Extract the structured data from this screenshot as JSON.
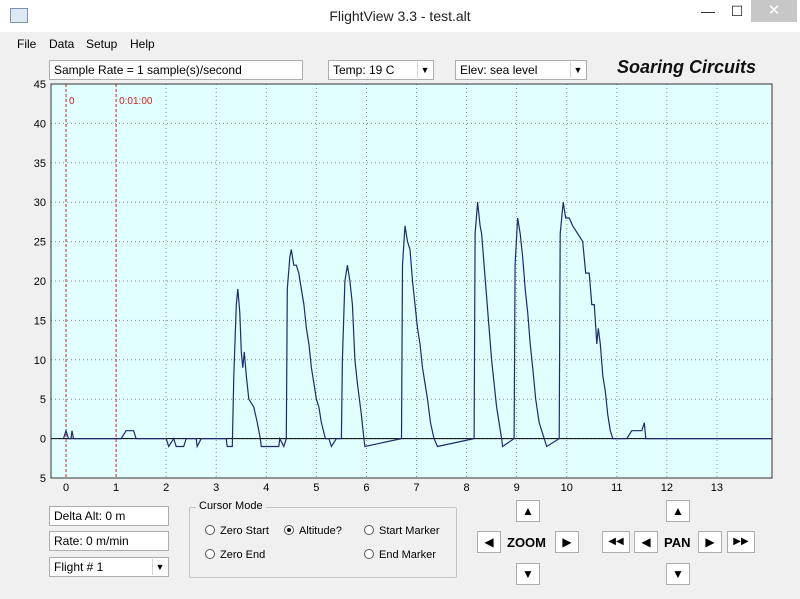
{
  "window": {
    "title": "FlightView 3.3 - test.alt",
    "minimize_glyph": "—",
    "maximize_glyph": "☐",
    "close_glyph": "✕"
  },
  "menu": [
    "File",
    "Data",
    "Setup",
    "Help"
  ],
  "toolbar": {
    "sample_rate": "Sample Rate =  1 sample(s)/second",
    "temp": "Temp:  19 C",
    "elev": "Elev: sea level",
    "brand": "Soaring Circuits"
  },
  "chart_data": {
    "type": "line",
    "x_ticks": [
      "0",
      "1",
      "2",
      "3",
      "4",
      "5",
      "6",
      "7",
      "8",
      "9",
      "10",
      "11",
      "12",
      "13"
    ],
    "y_ticks": [
      "45",
      "40",
      "35",
      "30",
      "25",
      "20",
      "15",
      "10",
      "5",
      "0",
      "5"
    ],
    "xlim": [
      -0.3,
      14.1
    ],
    "ylim": [
      -5,
      45
    ],
    "grid": true,
    "markers": [
      {
        "x": 0,
        "label": "0"
      },
      {
        "x": 1,
        "label": "0:01:00"
      }
    ],
    "colors": {
      "background": "#e2ffff",
      "line": "#1d2a6e",
      "marker": "#d42020",
      "grid": "#8a8a8a"
    },
    "points": [
      [
        -0.05,
        0
      ],
      [
        0.0,
        1
      ],
      [
        0.05,
        0
      ],
      [
        0.1,
        0
      ],
      [
        0.12,
        1
      ],
      [
        0.15,
        0
      ],
      [
        0.2,
        0
      ],
      [
        1.1,
        0
      ],
      [
        1.2,
        1
      ],
      [
        1.35,
        1
      ],
      [
        1.4,
        0
      ],
      [
        2.0,
        0
      ],
      [
        2.05,
        -1
      ],
      [
        2.15,
        0
      ],
      [
        2.2,
        -1
      ],
      [
        2.35,
        -1
      ],
      [
        2.4,
        0
      ],
      [
        2.6,
        0
      ],
      [
        2.62,
        -1
      ],
      [
        2.7,
        0
      ],
      [
        3.2,
        0
      ],
      [
        3.22,
        -1
      ],
      [
        3.32,
        -1
      ],
      [
        3.35,
        8
      ],
      [
        3.4,
        17
      ],
      [
        3.43,
        19
      ],
      [
        3.47,
        16
      ],
      [
        3.5,
        11
      ],
      [
        3.53,
        9
      ],
      [
        3.56,
        11
      ],
      [
        3.6,
        8
      ],
      [
        3.65,
        5
      ],
      [
        3.75,
        4
      ],
      [
        3.82,
        2
      ],
      [
        3.88,
        0
      ],
      [
        3.9,
        -1
      ],
      [
        4.25,
        -1
      ],
      [
        4.27,
        0
      ],
      [
        4.35,
        -1
      ],
      [
        4.4,
        0
      ],
      [
        4.42,
        19
      ],
      [
        4.47,
        23
      ],
      [
        4.5,
        24
      ],
      [
        4.55,
        22
      ],
      [
        4.6,
        22
      ],
      [
        4.65,
        21
      ],
      [
        4.7,
        19
      ],
      [
        4.75,
        17
      ],
      [
        4.8,
        14
      ],
      [
        4.85,
        12
      ],
      [
        4.9,
        9
      ],
      [
        4.95,
        7
      ],
      [
        5.0,
        5
      ],
      [
        5.05,
        4
      ],
      [
        5.1,
        2
      ],
      [
        5.18,
        0
      ],
      [
        5.25,
        0
      ],
      [
        5.3,
        -1
      ],
      [
        5.4,
        0
      ],
      [
        5.5,
        0
      ],
      [
        5.52,
        10
      ],
      [
        5.57,
        20
      ],
      [
        5.62,
        22
      ],
      [
        5.67,
        20
      ],
      [
        5.72,
        17
      ],
      [
        5.77,
        10
      ],
      [
        5.82,
        7
      ],
      [
        5.86,
        5
      ],
      [
        5.9,
        3
      ],
      [
        5.95,
        0
      ],
      [
        5.97,
        -1
      ],
      [
        6.7,
        0
      ],
      [
        6.72,
        22
      ],
      [
        6.77,
        27
      ],
      [
        6.82,
        25
      ],
      [
        6.87,
        24
      ],
      [
        6.92,
        20
      ],
      [
        6.97,
        17
      ],
      [
        7.02,
        14
      ],
      [
        7.07,
        12
      ],
      [
        7.12,
        9
      ],
      [
        7.17,
        7
      ],
      [
        7.22,
        5
      ],
      [
        7.28,
        2
      ],
      [
        7.35,
        0
      ],
      [
        7.42,
        -1
      ],
      [
        8.15,
        0
      ],
      [
        8.17,
        26
      ],
      [
        8.22,
        30
      ],
      [
        8.27,
        27
      ],
      [
        8.3,
        26
      ],
      [
        8.35,
        22
      ],
      [
        8.4,
        18
      ],
      [
        8.45,
        14
      ],
      [
        8.5,
        10
      ],
      [
        8.55,
        7
      ],
      [
        8.6,
        4
      ],
      [
        8.65,
        2
      ],
      [
        8.7,
        0
      ],
      [
        8.72,
        -1
      ],
      [
        8.95,
        0
      ],
      [
        8.97,
        22
      ],
      [
        9.02,
        28
      ],
      [
        9.07,
        26
      ],
      [
        9.12,
        23
      ],
      [
        9.17,
        19
      ],
      [
        9.22,
        16
      ],
      [
        9.27,
        12
      ],
      [
        9.32,
        9
      ],
      [
        9.38,
        5
      ],
      [
        9.45,
        2
      ],
      [
        9.55,
        0
      ],
      [
        9.6,
        -1
      ],
      [
        9.85,
        0
      ],
      [
        9.87,
        26
      ],
      [
        9.93,
        30
      ],
      [
        9.98,
        28
      ],
      [
        10.05,
        28
      ],
      [
        10.12,
        27
      ],
      [
        10.22,
        26
      ],
      [
        10.32,
        25
      ],
      [
        10.38,
        21
      ],
      [
        10.45,
        21
      ],
      [
        10.5,
        17
      ],
      [
        10.55,
        17
      ],
      [
        10.6,
        12
      ],
      [
        10.63,
        14
      ],
      [
        10.67,
        12
      ],
      [
        10.72,
        8
      ],
      [
        10.77,
        6
      ],
      [
        10.82,
        3
      ],
      [
        10.87,
        1
      ],
      [
        10.92,
        0
      ],
      [
        11.0,
        0
      ],
      [
        11.2,
        0
      ],
      [
        11.3,
        1
      ],
      [
        11.5,
        1
      ],
      [
        11.55,
        2
      ],
      [
        11.58,
        0
      ],
      [
        14.1,
        0
      ]
    ]
  },
  "bottom": {
    "delta_alt": "Delta Alt: 0 m",
    "rate": "Rate: 0 m/min",
    "flight": "Flight # 1",
    "cursor_mode": {
      "title": "Cursor Mode",
      "options": {
        "zero_start": "Zero Start",
        "altitude": "Altitude?",
        "start_marker": "Start Marker",
        "zero_end": "Zero End",
        "end_marker": "End Marker"
      },
      "selected": "Altitude?"
    },
    "zoom_label": "ZOOM",
    "pan_label": "PAN",
    "glyphs": {
      "up": "▲",
      "down": "▼",
      "left": "◀",
      "right": "▶",
      "fast_left": "◀◀",
      "fast_right": "▶▶",
      "dropdown": "▼"
    }
  }
}
